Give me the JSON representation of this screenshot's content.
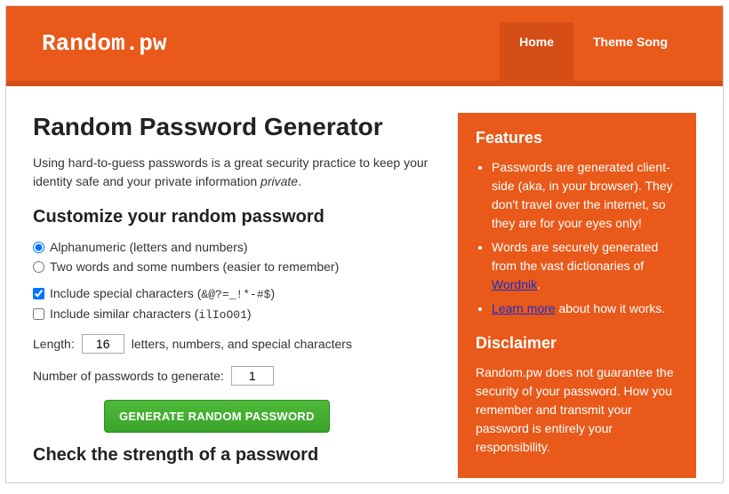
{
  "header": {
    "logo": "Random.pw",
    "nav": [
      {
        "label": "Home",
        "active": true
      },
      {
        "label": "Theme Song",
        "active": false
      }
    ]
  },
  "main": {
    "title": "Random Password Generator",
    "intro_pre": "Using hard-to-guess passwords is a great security practice to keep your identity safe and your private information ",
    "intro_em": "private",
    "intro_post": ".",
    "customize_heading": "Customize your random password",
    "mode": {
      "alpha": {
        "label": "Alphanumeric (letters and numbers)",
        "checked": true
      },
      "words": {
        "label": "Two words and some numbers (easier to remember)",
        "checked": false
      }
    },
    "special": {
      "label_pre": "Include special characters (",
      "chars": "&@?=_!*-#$",
      "label_post": ")",
      "checked": true
    },
    "similar": {
      "label_pre": "Include similar characters (",
      "chars": "ilIoO01",
      "label_post": ")",
      "checked": false
    },
    "length": {
      "label_pre": "Length:",
      "value": "16",
      "label_post": "letters, numbers, and special characters"
    },
    "count": {
      "label": "Number of passwords to generate:",
      "value": "1"
    },
    "generate_btn": "GENERATE RANDOM PASSWORD",
    "strength_heading": "Check the strength of a password"
  },
  "sidebar": {
    "features_heading": "Features",
    "feature1": "Passwords are generated client-side (aka, in your browser). They don't travel over the internet, so they are for your eyes only!",
    "feature2_pre": "Words are securely generated from the vast dictionaries of ",
    "feature2_link": "Wordnik",
    "feature2_post": ".",
    "feature3_link": "Learn more",
    "feature3_post": " about how it works.",
    "disclaimer_heading": "Disclaimer",
    "disclaimer_body": "Random.pw does not guarantee the security of your password. How you remember and transmit your password is entirely your responsibility."
  }
}
